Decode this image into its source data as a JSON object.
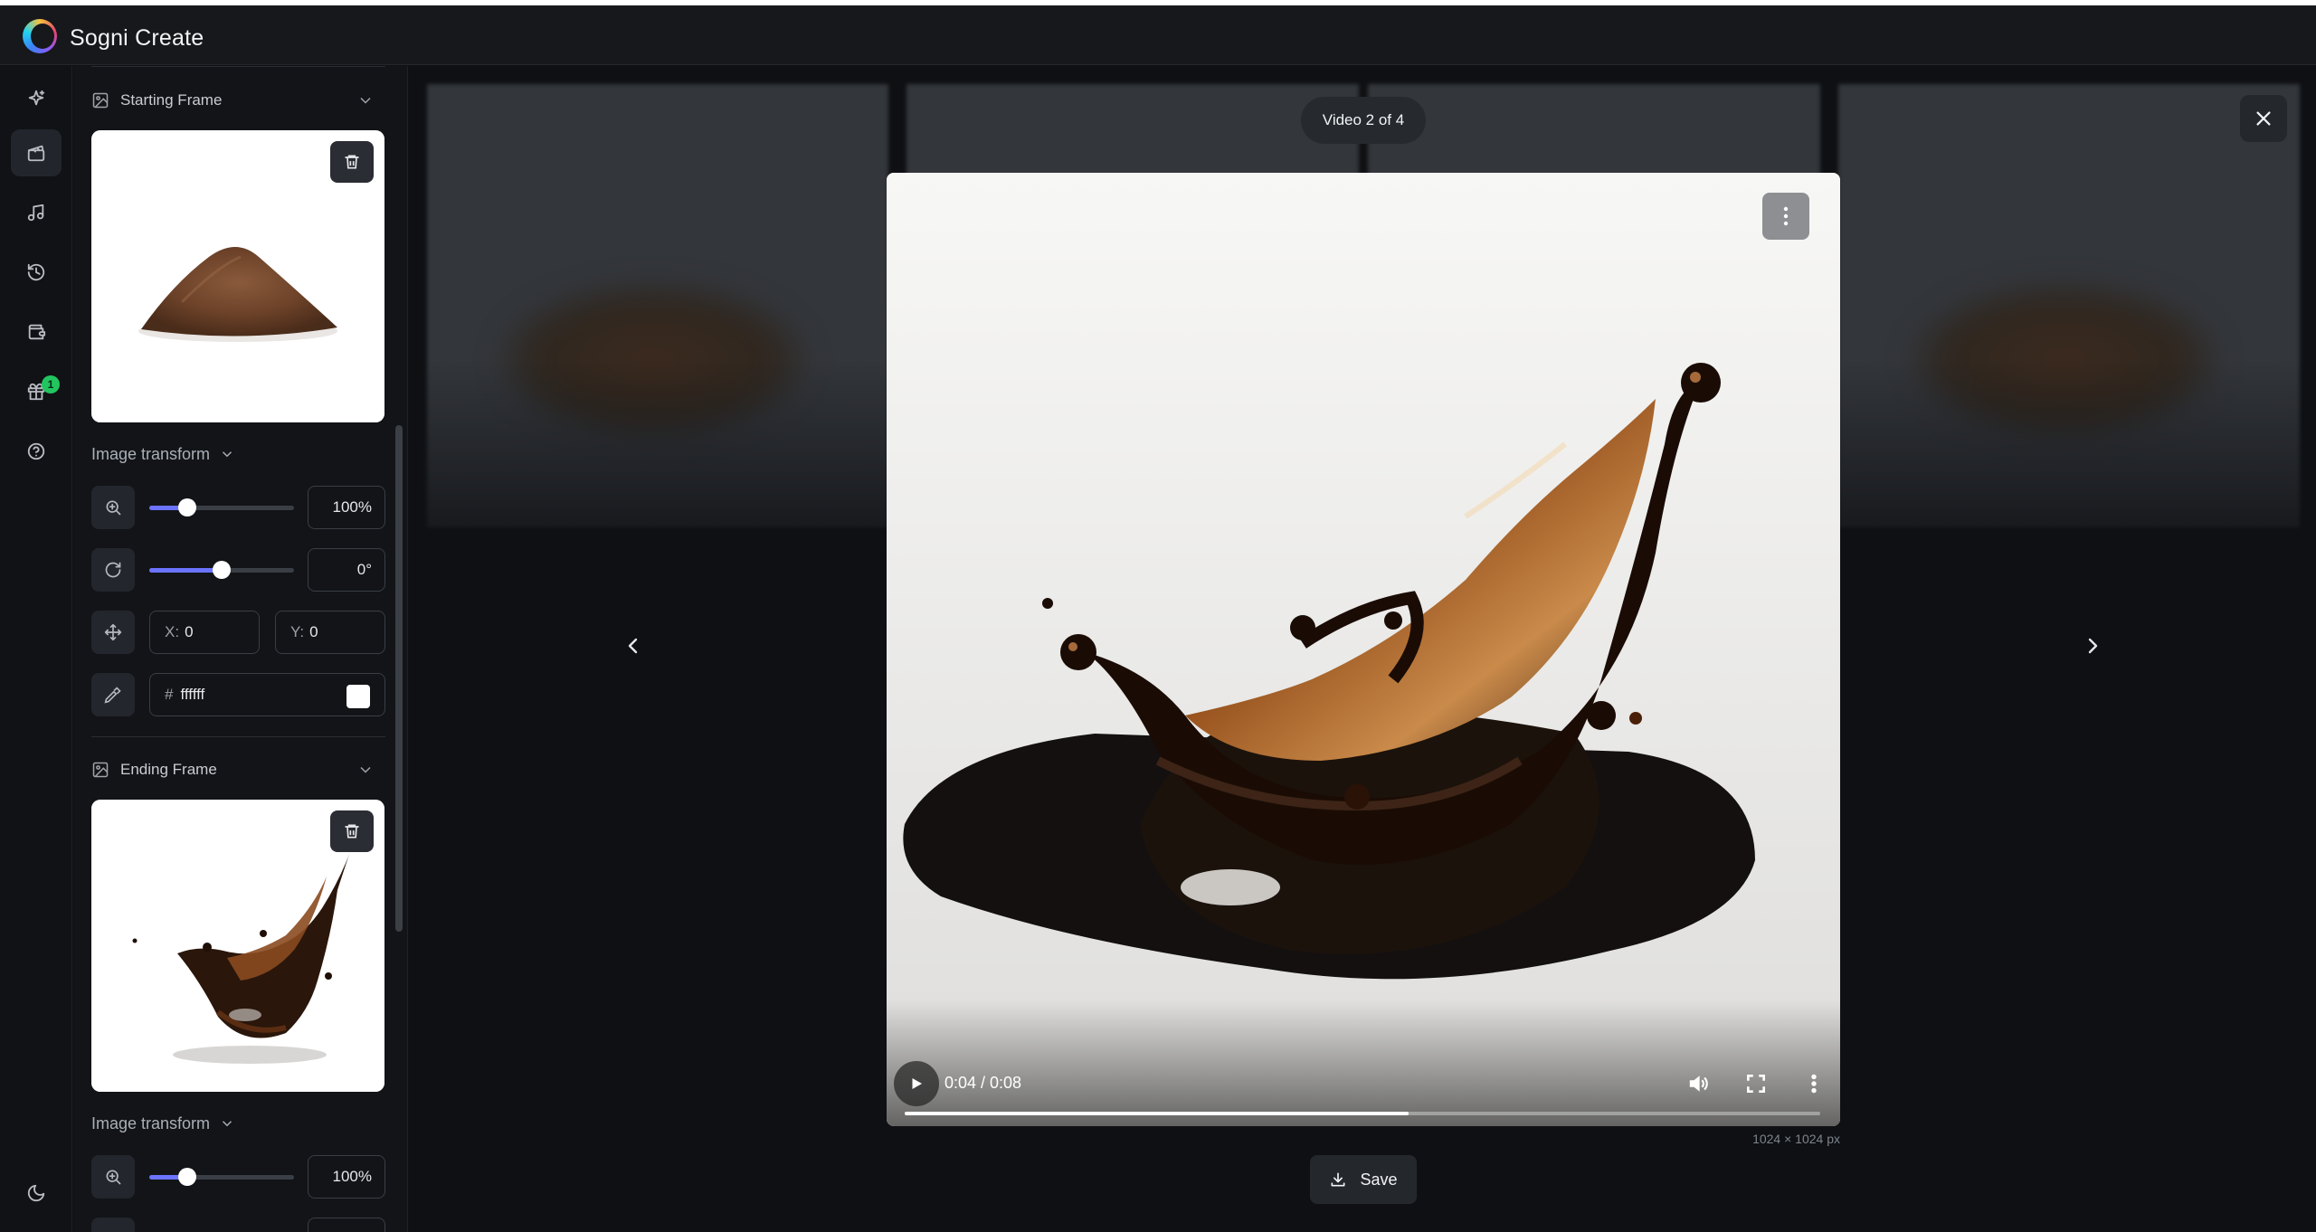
{
  "app": {
    "title": "Sogni Create"
  },
  "rail": {
    "items": [
      {
        "icon": "sparkles-icon",
        "label": "Create"
      },
      {
        "icon": "clapperboard-icon",
        "label": "Video",
        "active": true
      },
      {
        "icon": "music-note-icon",
        "label": "Audio"
      },
      {
        "icon": "history-icon",
        "label": "History"
      },
      {
        "icon": "wallet-icon",
        "label": "Wallet"
      },
      {
        "icon": "gift-icon",
        "label": "Rewards",
        "badge": "1"
      },
      {
        "icon": "help-icon",
        "label": "Help"
      }
    ],
    "bottom_icon": "moon-icon"
  },
  "panel": {
    "starting_frame": {
      "title": "Starting Frame",
      "transform_label": "Image transform",
      "zoom": {
        "value_text": "100%",
        "level": 0.26
      },
      "rotation": {
        "value_text": "0°",
        "level": 0.5
      },
      "position": {
        "x_label": "X:",
        "x_value": "0",
        "y_label": "Y:",
        "y_value": "0"
      },
      "background": {
        "hash": "#",
        "hex": "ffffff",
        "swatch_color": "#ffffff"
      }
    },
    "ending_frame": {
      "title": "Ending Frame",
      "transform_label": "Image transform",
      "zoom": {
        "value_text": "100%",
        "level": 0.26
      }
    }
  },
  "viewer": {
    "counter": "Video 2 of 4",
    "video": {
      "time": "0:04 / 0:08",
      "progress": 0.55,
      "dimensions": "1024 × 1024 px"
    },
    "save_label": "Save"
  },
  "colors": {
    "accent": "#6b73ff",
    "badge": "#22c55e",
    "background": "#0e1013"
  }
}
